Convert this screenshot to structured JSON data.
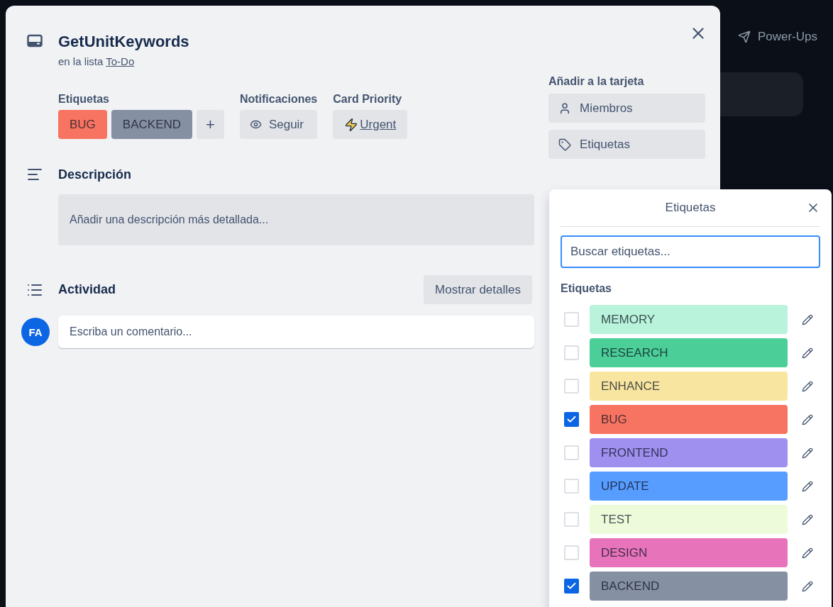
{
  "backdrop": {
    "powerups": "Power-Ups"
  },
  "card": {
    "title": "GetUnitKeywords",
    "list_prefix": "en la lista",
    "list_name": "To-Do",
    "labels_heading": "Etiquetas",
    "labels": [
      {
        "name": "BUG",
        "color": "#f87462"
      },
      {
        "name": "BACKEND",
        "color": "#8590a2"
      }
    ],
    "add_label": "+",
    "notifications": {
      "heading": "Notificaciones",
      "button": "Seguir"
    },
    "priority": {
      "heading": "Card Priority",
      "value": "Urgent"
    },
    "description": {
      "heading": "Descripción",
      "prompt": "Añadir una descripción más detallada..."
    },
    "activity": {
      "heading": "Actividad",
      "button": "Mostrar detalles",
      "avatar": "FA",
      "comment_placeholder": "Escriba un comentario..."
    }
  },
  "sidebar": {
    "heading": "Añadir a la tarjeta",
    "buttons": [
      {
        "kind": "members",
        "label": "Miembros"
      },
      {
        "kind": "labels",
        "label": "Etiquetas"
      }
    ]
  },
  "labels_popover": {
    "title": "Etiquetas",
    "search_placeholder": "Buscar etiquetas...",
    "section": "Etiquetas",
    "items": [
      {
        "name": "MEMORY",
        "color": "#baf3db",
        "checked": false
      },
      {
        "name": "RESEARCH",
        "color": "#4bce97",
        "checked": false
      },
      {
        "name": "ENHANCE",
        "color": "#f8e6a0",
        "checked": false
      },
      {
        "name": "BUG",
        "color": "#f87462",
        "checked": true
      },
      {
        "name": "FRONTEND",
        "color": "#9f8fef",
        "checked": false
      },
      {
        "name": "UPDATE",
        "color": "#579dff",
        "checked": false
      },
      {
        "name": "TEST",
        "color": "#eefbda",
        "checked": false
      },
      {
        "name": "DESIGN",
        "color": "#e774bb",
        "checked": false
      },
      {
        "name": "BACKEND",
        "color": "#8590a2",
        "checked": true
      }
    ]
  }
}
